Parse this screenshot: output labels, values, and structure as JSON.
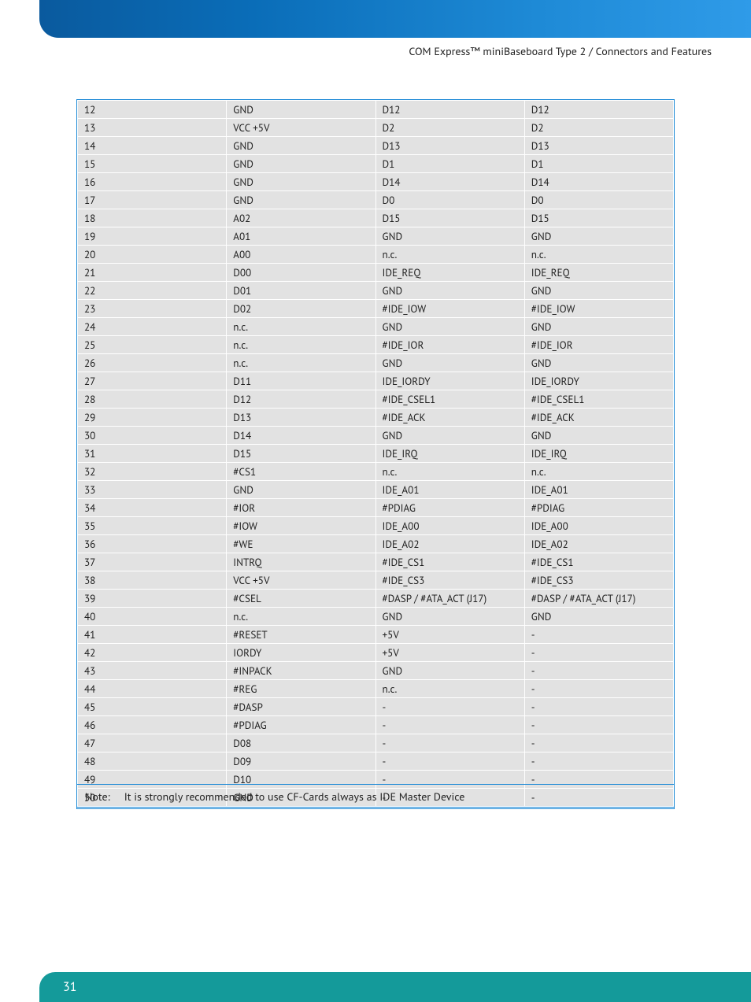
{
  "header": {
    "breadcrumb": "COM Express™ miniBaseboard Type 2 / Connectors and Features"
  },
  "table": {
    "rows": [
      {
        "c1": "12",
        "c2": "GND",
        "c3": "D12",
        "c4": "D12"
      },
      {
        "c1": "13",
        "c2": "VCC +5V",
        "c3": "D2",
        "c4": "D2"
      },
      {
        "c1": "14",
        "c2": "GND",
        "c3": "D13",
        "c4": "D13"
      },
      {
        "c1": "15",
        "c2": "GND",
        "c3": "D1",
        "c4": "D1"
      },
      {
        "c1": "16",
        "c2": "GND",
        "c3": "D14",
        "c4": "D14"
      },
      {
        "c1": "17",
        "c2": "GND",
        "c3": "D0",
        "c4": "D0"
      },
      {
        "c1": "18",
        "c2": "A02",
        "c3": "D15",
        "c4": "D15"
      },
      {
        "c1": "19",
        "c2": "A01",
        "c3": "GND",
        "c4": "GND"
      },
      {
        "c1": "20",
        "c2": "A00",
        "c3": "n.c.",
        "c4": "n.c."
      },
      {
        "c1": "21",
        "c2": "D00",
        "c3": "IDE_REQ",
        "c4": "IDE_REQ"
      },
      {
        "c1": "22",
        "c2": "D01",
        "c3": "GND",
        "c4": "GND"
      },
      {
        "c1": "23",
        "c2": "D02",
        "c3": "#IDE_IOW",
        "c4": "#IDE_IOW"
      },
      {
        "c1": "24",
        "c2": "n.c.",
        "c3": "GND",
        "c4": "GND"
      },
      {
        "c1": "25",
        "c2": "n.c.",
        "c3": "#IDE_IOR",
        "c4": "#IDE_IOR"
      },
      {
        "c1": "26",
        "c2": "n.c.",
        "c3": "GND",
        "c4": "GND"
      },
      {
        "c1": "27",
        "c2": "D11",
        "c3": "IDE_IORDY",
        "c4": "IDE_IORDY"
      },
      {
        "c1": "28",
        "c2": "D12",
        "c3": "#IDE_CSEL1",
        "c4": "#IDE_CSEL1"
      },
      {
        "c1": "29",
        "c2": "D13",
        "c3": "#IDE_ACK",
        "c4": "#IDE_ACK"
      },
      {
        "c1": "30",
        "c2": "D14",
        "c3": "GND",
        "c4": "GND"
      },
      {
        "c1": "31",
        "c2": "D15",
        "c3": "IDE_IRQ",
        "c4": "IDE_IRQ"
      },
      {
        "c1": "32",
        "c2": "#CS1",
        "c3": "n.c.",
        "c4": "n.c."
      },
      {
        "c1": "33",
        "c2": "GND",
        "c3": "IDE_A01",
        "c4": "IDE_A01"
      },
      {
        "c1": "34",
        "c2": "#IOR",
        "c3": "#PDIAG",
        "c4": "#PDIAG"
      },
      {
        "c1": "35",
        "c2": "#IOW",
        "c3": "IDE_A00",
        "c4": "IDE_A00"
      },
      {
        "c1": "36",
        "c2": "#WE",
        "c3": "IDE_A02",
        "c4": "IDE_A02"
      },
      {
        "c1": "37",
        "c2": "INTRQ",
        "c3": "#IDE_CS1",
        "c4": "#IDE_CS1"
      },
      {
        "c1": "38",
        "c2": "VCC +5V",
        "c3": "#IDE_CS3",
        "c4": "#IDE_CS3"
      },
      {
        "c1": "39",
        "c2": "#CSEL",
        "c3": "#DASP / #ATA_ACT (J17)",
        "c4": "#DASP / #ATA_ACT (J17)"
      },
      {
        "c1": "40",
        "c2": "n.c.",
        "c3": "GND",
        "c4": "GND"
      },
      {
        "c1": "41",
        "c2": "#RESET",
        "c3": "+5V",
        "c4": "-"
      },
      {
        "c1": "42",
        "c2": "IORDY",
        "c3": "+5V",
        "c4": "-"
      },
      {
        "c1": "43",
        "c2": "#INPACK",
        "c3": "GND",
        "c4": "-"
      },
      {
        "c1": "44",
        "c2": "#REG",
        "c3": "n.c.",
        "c4": "-"
      },
      {
        "c1": "45",
        "c2": "#DASP",
        "c3": "-",
        "c4": "-"
      },
      {
        "c1": "46",
        "c2": "#PDIAG",
        "c3": "-",
        "c4": "-"
      },
      {
        "c1": "47",
        "c2": "D08",
        "c3": "-",
        "c4": "-"
      },
      {
        "c1": "48",
        "c2": "D09",
        "c3": "-",
        "c4": "-"
      },
      {
        "c1": "49",
        "c2": "D10",
        "c3": "-",
        "c4": "-"
      },
      {
        "c1": "50",
        "c2": "GND",
        "c3": "-",
        "c4": "-"
      }
    ]
  },
  "note": {
    "label": "Note:",
    "text": "It is strongly recommended to use CF-Cards always as IDE Master Device"
  },
  "footer": {
    "page_number": "31"
  }
}
